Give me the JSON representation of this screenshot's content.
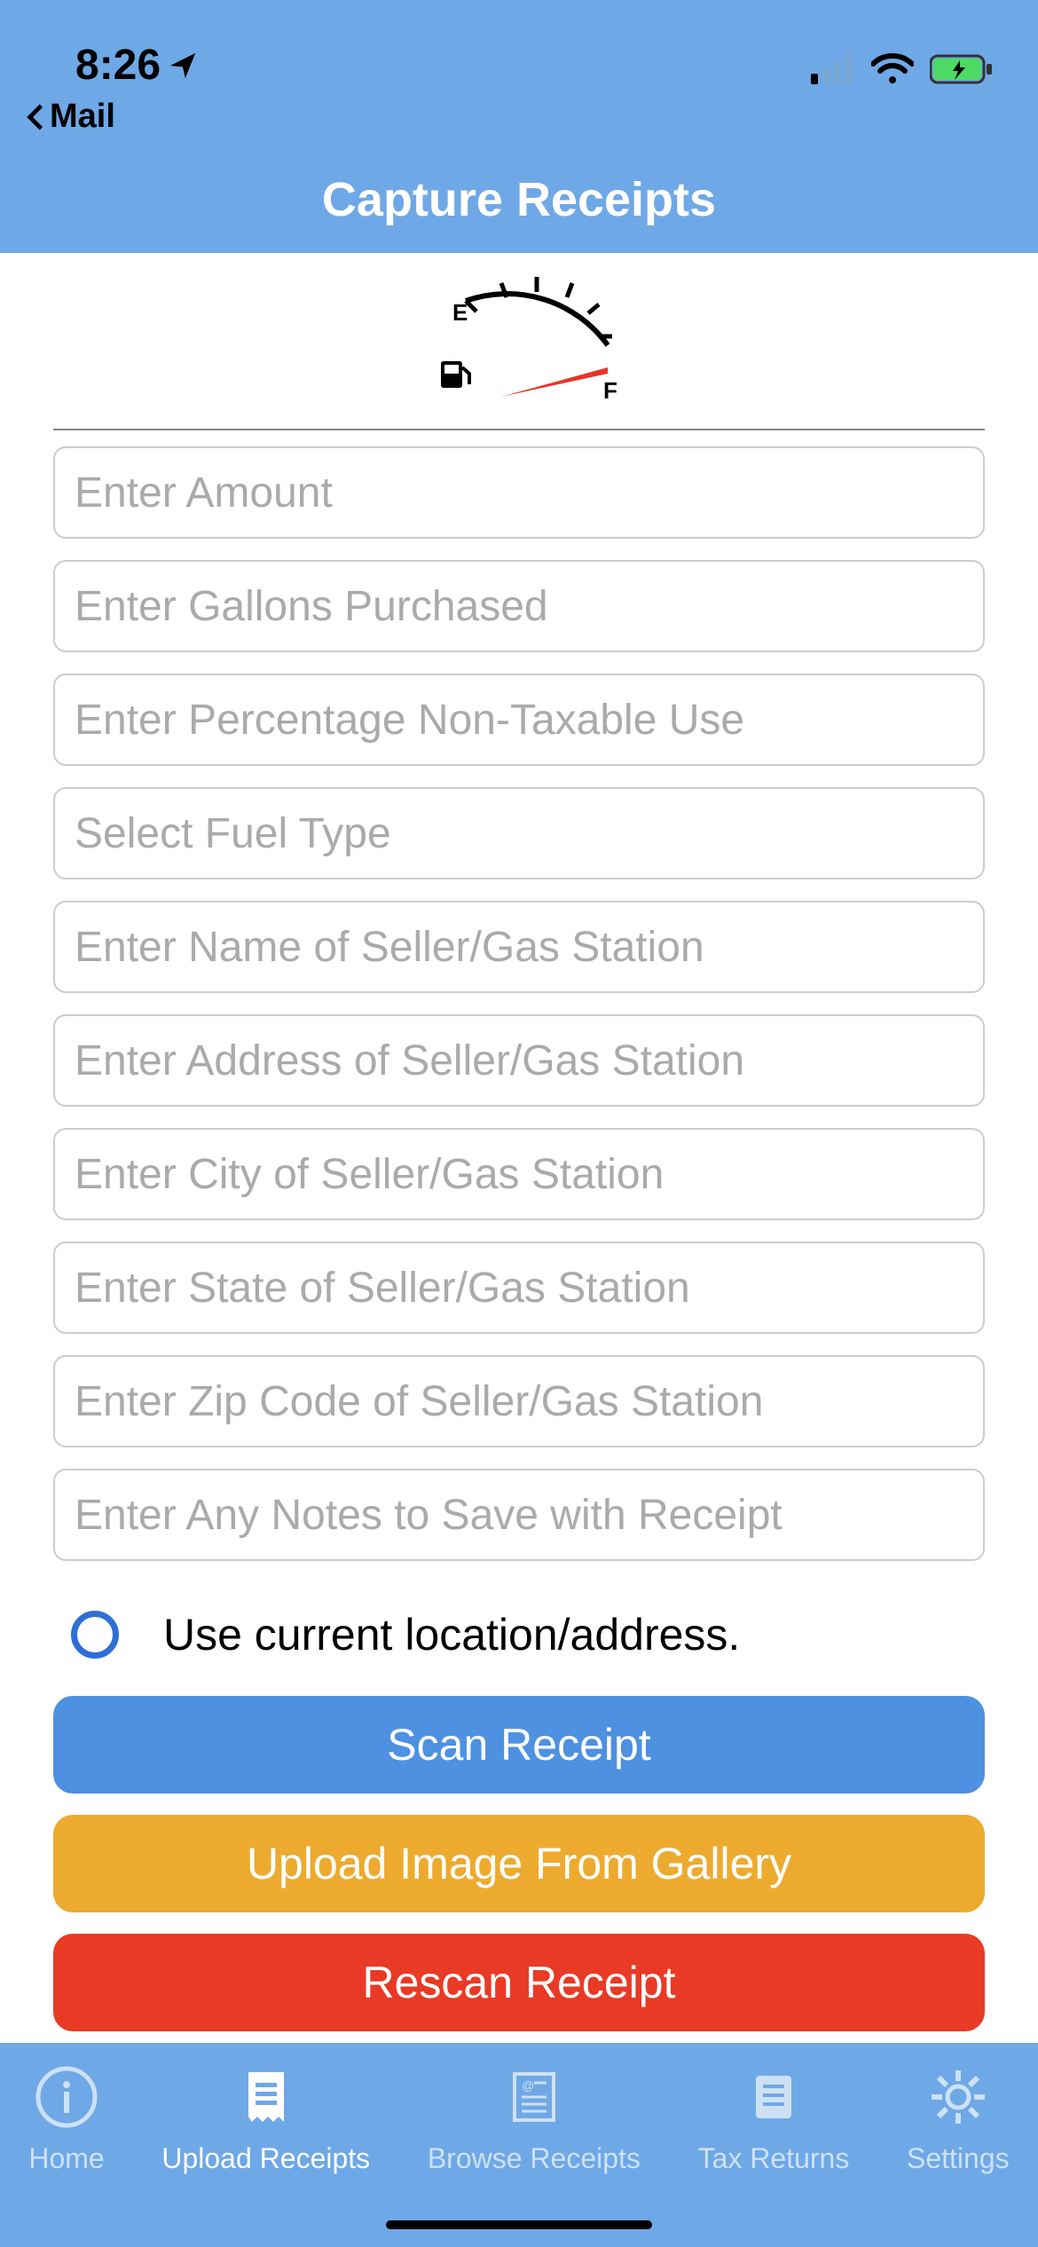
{
  "status": {
    "time": "8:26",
    "back_label": "Mail"
  },
  "header": {
    "title": "Capture Receipts"
  },
  "gauge": {
    "empty_label": "E",
    "full_label": "F"
  },
  "form": {
    "amount_placeholder": "Enter Amount",
    "gallons_placeholder": "Enter Gallons Purchased",
    "percentage_placeholder": "Enter Percentage Non-Taxable Use",
    "fuel_type_placeholder": "Select Fuel Type",
    "seller_name_placeholder": "Enter Name of Seller/Gas Station",
    "seller_address_placeholder": "Enter Address of Seller/Gas Station",
    "seller_city_placeholder": "Enter City of Seller/Gas Station",
    "seller_state_placeholder": "Enter State of Seller/Gas Station",
    "seller_zip_placeholder": "Enter Zip Code of Seller/Gas Station",
    "notes_placeholder": "Enter Any Notes to Save with Receipt",
    "location_label": "Use current location/address."
  },
  "buttons": {
    "scan": "Scan Receipt",
    "upload": "Upload Image From Gallery",
    "rescan": "Rescan Receipt"
  },
  "tabs": {
    "home": "Home",
    "upload": "Upload Receipts",
    "browse": "Browse Receipts",
    "tax": "Tax Returns",
    "settings": "Settings"
  }
}
